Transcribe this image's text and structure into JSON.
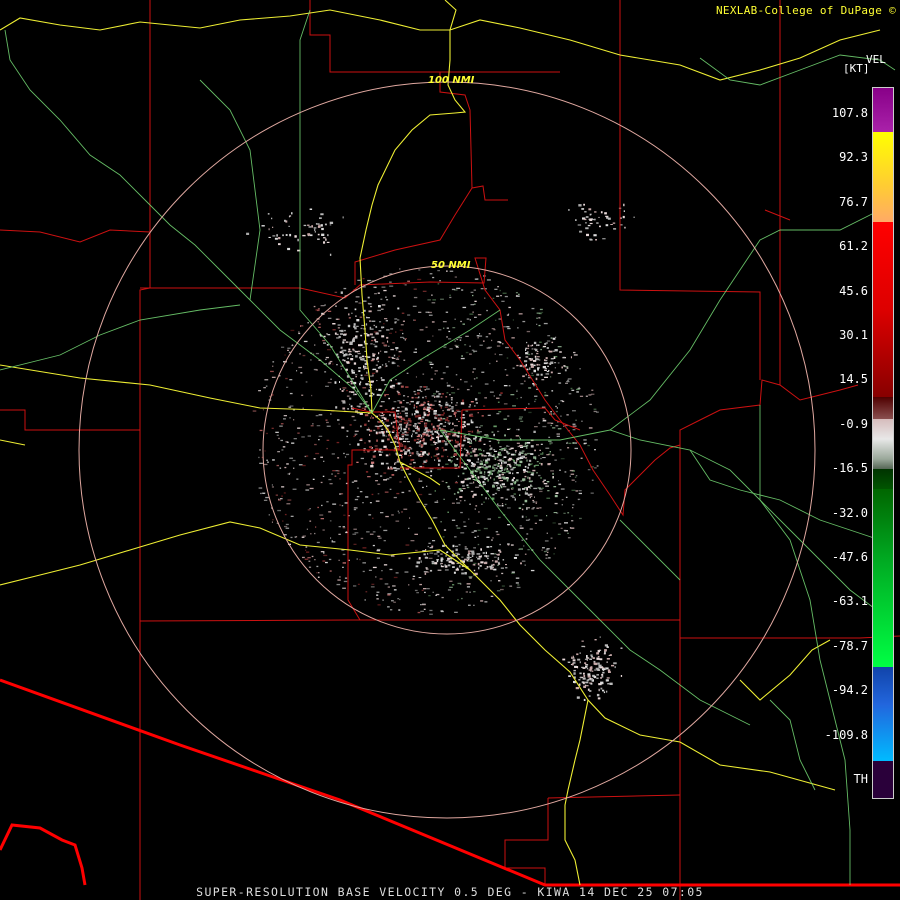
{
  "credit": "NEXLAB-College of DuPage ©",
  "legend": {
    "product": "VEL",
    "unit": "[KT]",
    "ticks": [
      "107.8",
      "92.3",
      "76.7",
      "61.2",
      "45.6",
      "30.1",
      "14.5",
      "-0.9",
      "-16.5",
      "-32.0",
      "-47.6",
      "-63.1",
      "-78.7",
      "-94.2",
      "-109.8",
      "TH"
    ],
    "colors": {
      "th": "#2a003a",
      "purple": "#880088",
      "yellow": "#ffff00",
      "orange": "#ffb070",
      "red": "#ff0000",
      "darkred": "#600000",
      "gray": "#c8c8c8",
      "darkgreen": "#005500",
      "green": "#00ff44",
      "blue": "#2266dd",
      "cyan": "#00bbff"
    }
  },
  "rings": {
    "inner_label": "50 NMI",
    "outer_label": "100 NMI"
  },
  "footer": "SUPER-RESOLUTION BASE VELOCITY 0.5 DEG - KIWA 14 DEC 25 07:05",
  "map_colors": {
    "county": "#cc1111",
    "border": "#ff0000",
    "highway": "#eeee33",
    "road": "#77dd77",
    "ring": "#e0a8a0"
  }
}
